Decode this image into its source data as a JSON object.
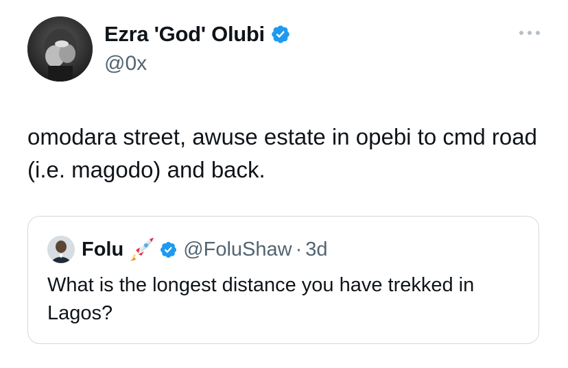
{
  "tweet": {
    "author": {
      "name": "Ezra 'God' Olubi",
      "handle": "@0x",
      "verified": true,
      "avatar_icon": "user-avatar-photo"
    },
    "more_icon": "more-dots-icon",
    "text": "omodara street, awuse estate in opebi to cmd road (i.e. magodo) and back."
  },
  "quote": {
    "author": {
      "name": "Folu",
      "emoji": "rocket-emoji",
      "handle": "@FoluShaw",
      "verified": true,
      "avatar_icon": "user-avatar-photo"
    },
    "separator": "·",
    "time": "3d",
    "text": "What is the longest distance you have trekked in Lagos?"
  },
  "colors": {
    "verified_blue": "#1d9bf0",
    "secondary_text": "#536471",
    "border": "#cfd9de",
    "primary_text": "#0f1419"
  }
}
